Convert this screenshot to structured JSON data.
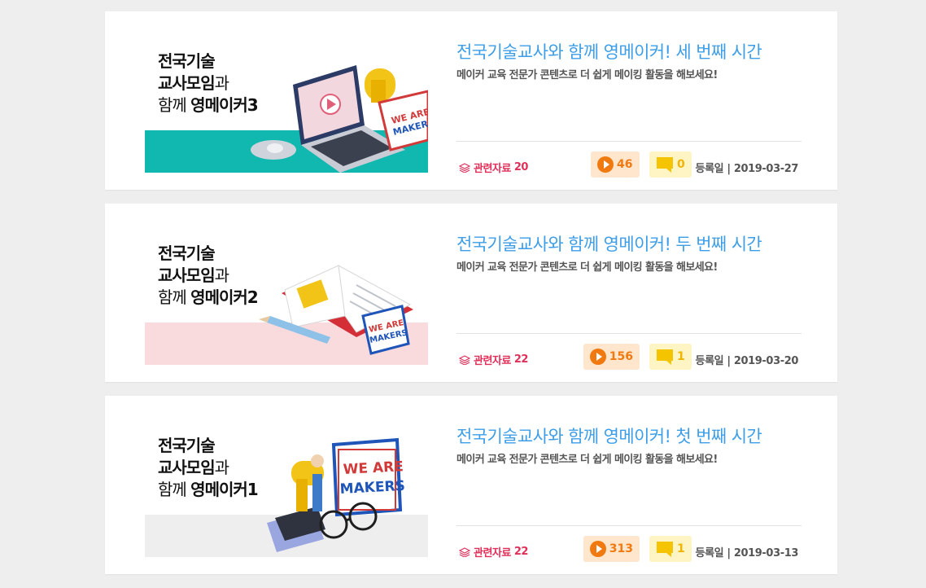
{
  "cards": [
    {
      "thumb_line1": "전국기술",
      "thumb_line2_bold": "교사모임",
      "thumb_line2_thin": "과",
      "thumb_line3_thin": "함께 ",
      "thumb_line3_bold": "영메이커3",
      "band_color": "#10b8b0",
      "title": "전국기술교사와 함께 영메이커! 세 번째 시간",
      "desc": "메이커 교육 전문가 콘텐츠로 더 쉽게 메이킹 활동을 해보세요!",
      "related_label": "관련자료",
      "related_count": "20",
      "views": "46",
      "comments": "0",
      "date_label": "등록일 |",
      "date": "2019-03-27"
    },
    {
      "thumb_line1": "전국기술",
      "thumb_line2_bold": "교사모임",
      "thumb_line2_thin": "과",
      "thumb_line3_thin": "함께 ",
      "thumb_line3_bold": "영메이커2",
      "band_color": "#f9dadd",
      "title": "전국기술교사와 함께 영메이커! 두 번째 시간",
      "desc": "메이커 교육 전문가 콘텐츠로 더 쉽게 메이킹 활동을 해보세요!",
      "related_label": "관련자료",
      "related_count": "22",
      "views": "156",
      "comments": "1",
      "date_label": "등록일 |",
      "date": "2019-03-20"
    },
    {
      "thumb_line1": "전국기술",
      "thumb_line2_bold": "교사모임",
      "thumb_line2_thin": "과",
      "thumb_line3_thin": "함께 ",
      "thumb_line3_bold": "영메이커1",
      "band_color": "#eeeeee",
      "title": "전국기술교사와 함께 영메이커! 첫 번째 시간",
      "desc": "메이커 교육 전문가 콘텐츠로 더 쉽게 메이킹 활동을 해보세요!",
      "related_label": "관련자료",
      "related_count": "22",
      "views": "313",
      "comments": "1",
      "date_label": "등록일 |",
      "date": "2019-03-13"
    }
  ],
  "badge_text_line1": "WE ARE",
  "badge_text_line2": "MAKERS",
  "colors": {
    "title": "#3d9ee7",
    "related": "#e0305a",
    "views_bg": "#ffe6cc",
    "views_fg": "#f07a10",
    "comments_bg": "#fff5c4",
    "comments_fg": "#f0b400"
  },
  "icons": {
    "related": "layers-icon",
    "views": "play-circle-icon",
    "comments": "speech-bubble-icon"
  }
}
